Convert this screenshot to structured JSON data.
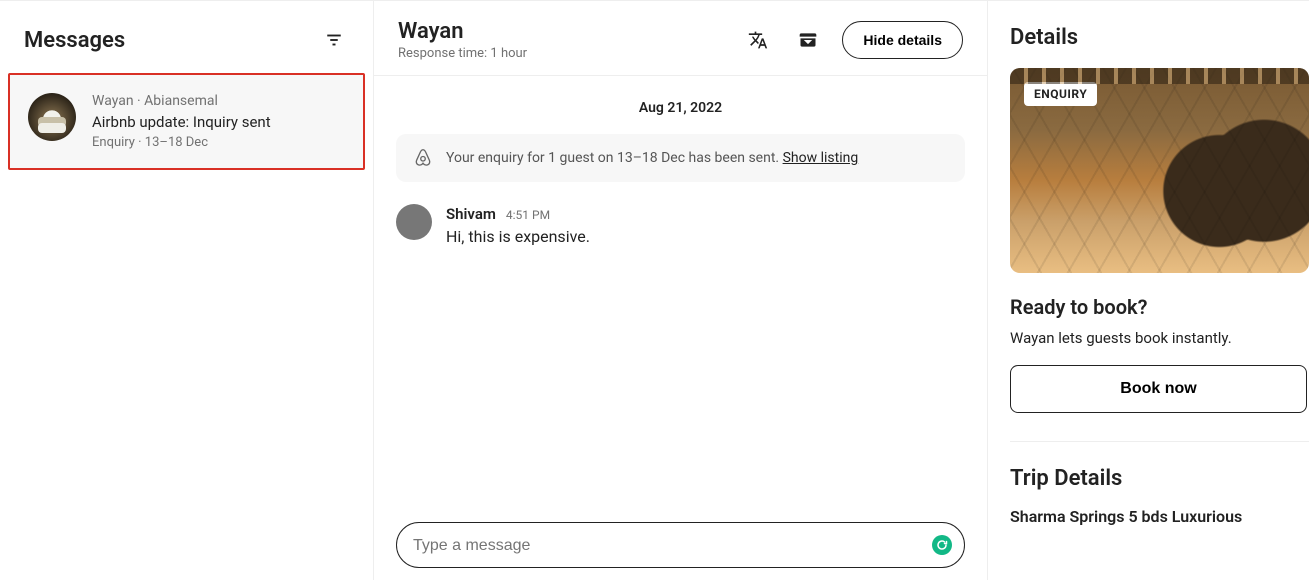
{
  "left": {
    "title": "Messages",
    "thread": {
      "line1": "Wayan · Abiansemal",
      "line2": "Airbnb update: Inquiry sent",
      "line3": "Enquiry · 13–18 Dec"
    }
  },
  "center": {
    "title": "Wayan",
    "subtitle": "Response time: 1 hour",
    "hide_details": "Hide details",
    "date": "Aug 21, 2022",
    "enquiry_text": "Your enquiry for 1 guest on 13–18 Dec has been sent. ",
    "show_listing": "Show listing",
    "message": {
      "sender": "Shivam",
      "time": "4:51 PM",
      "text": "Hi, this is expensive."
    },
    "composer_placeholder": "Type a message"
  },
  "right": {
    "title": "Details",
    "enquiry_tag": "ENQUIRY",
    "ready_title": "Ready to book?",
    "ready_sub": "Wayan lets guests book instantly.",
    "book_now": "Book now",
    "trip_title": "Trip Details",
    "listing_name": "Sharma Springs 5 bds Luxurious"
  }
}
